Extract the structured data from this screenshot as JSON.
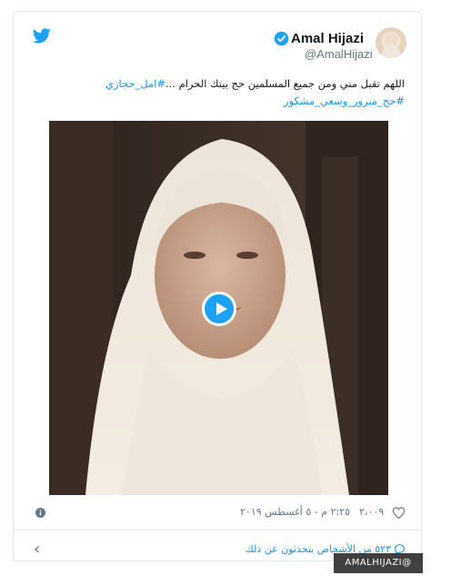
{
  "tweet": {
    "display_name": "Amal Hijazi",
    "handle": "@AmalHijazi",
    "text": "اللهم تقبل مني ومن جميع المسلمين حج بيتك الحرام ...",
    "hashtag_1": "#امل_حجازي",
    "hashtag_2": "#حج_مبرور_وسعي_مشكور",
    "likes": "٢،٠٠٩",
    "timestamp": "٢:٢٥ م - ٥ أغسطس ٢٠١٩",
    "reply_link": "٥٢٣ من الأشخاص يتحدثون عن ذلك"
  },
  "watermark": "AMALHIJAZI@",
  "icons": {
    "brand": "twitter-bird-icon",
    "verified": "verified-badge-icon",
    "play": "play-icon",
    "info": "info-icon",
    "like": "heart-icon",
    "reply": "speech-bubble-icon",
    "back": "chevron-left-icon"
  },
  "colors": {
    "brand_blue": "#1da1f2",
    "link_blue": "#1b95e0",
    "muted_gray": "#657786",
    "border": "#e1e8ed"
  }
}
